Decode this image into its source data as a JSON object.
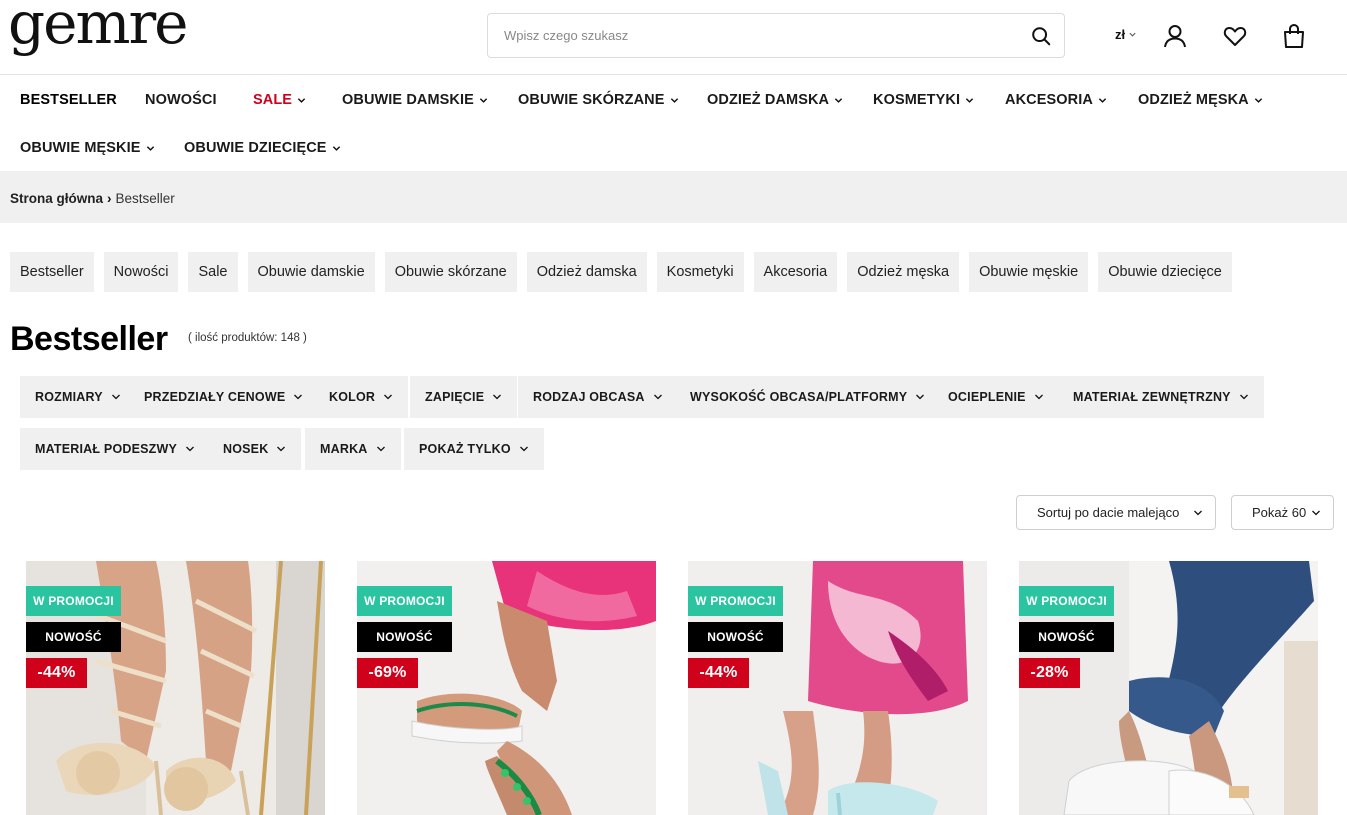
{
  "brand": {
    "logo_text": "gemre"
  },
  "search": {
    "placeholder": "Wpisz czego szukasz"
  },
  "header": {
    "currency": "zł"
  },
  "nav": {
    "items": [
      "BESTSELLER",
      "NOWOŚCI",
      "SALE",
      "OBUWIE DAMSKIE",
      "OBUWIE SKÓRZANE",
      "ODZIEŻ DAMSKA",
      "KOSMETYKI",
      "AKCESORIA",
      "ODZIEŻ MĘSKA",
      "OBUWIE MĘSKIE",
      "OBUWIE DZIECIĘCE"
    ]
  },
  "breadcrumb": {
    "home": "Strona główna",
    "separator": "›",
    "current": "Bestseller"
  },
  "categories": [
    "Bestseller",
    "Nowości",
    "Sale",
    "Obuwie damskie",
    "Obuwie skórzane",
    "Odzież damska",
    "Kosmetyki",
    "Akcesoria",
    "Odzież męska",
    "Obuwie męskie",
    "Obuwie dziecięce"
  ],
  "page": {
    "title": "Bestseller",
    "count": "( ilość produktów: 148 )"
  },
  "filters": [
    "ROZMIARY",
    "PRZEDZIAŁY CENOWE",
    "KOLOR",
    "ZAPIĘCIE",
    "RODZAJ OBCASA",
    "WYSOKOŚĆ OBCASA/PLATFORMY",
    "OCIEPLENIE",
    "MATERIAŁ ZEWNĘTRZNY",
    "MATERIAŁ PODESZWY",
    "NOSEK",
    "MARKA",
    "POKAŻ TYLKO"
  ],
  "sort": {
    "selected": "Sortuj po dacie malejąco"
  },
  "per_page": {
    "selected": "Pokaż 60"
  },
  "products": [
    {
      "badge_promo": "W PROMOCJI",
      "badge_new": "NOWOŚĆ",
      "discount": "-44%"
    },
    {
      "badge_promo": "W PROMOCJI",
      "badge_new": "NOWOŚĆ",
      "discount": "-69%"
    },
    {
      "badge_promo": "W PROMOCJI",
      "badge_new": "NOWOŚĆ",
      "discount": "-44%"
    },
    {
      "badge_promo": "W PROMOCJI",
      "badge_new": "NOWOŚĆ",
      "discount": "-28%"
    }
  ],
  "colors": {
    "promo_badge": "#2bc4a0",
    "new_badge": "#000000",
    "discount_badge": "#d0021b",
    "sale_nav": "#d0021b",
    "pill_bg": "#f0f0f0"
  }
}
